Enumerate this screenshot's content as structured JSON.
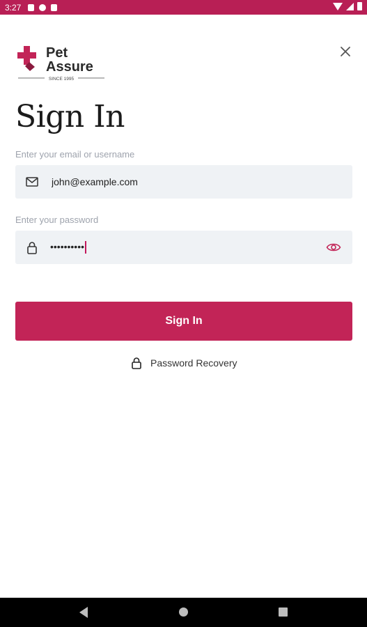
{
  "status_bar": {
    "time": "3:27",
    "icons": [
      "notification-icon",
      "circle-app-icon",
      "sd-card-icon",
      "wifi-icon",
      "signal-icon",
      "battery-icon"
    ]
  },
  "brand": {
    "name_line1": "Pet",
    "name_line2": "Assure",
    "tagline": "SINCE 1995",
    "color": "#c22457"
  },
  "page": {
    "title": "Sign In"
  },
  "form": {
    "email_label": "Enter your email or username",
    "email_value": "john@example.com",
    "password_label": "Enter your password",
    "password_value": "••••••••••",
    "submit_label": "Sign In",
    "recovery_label": "Password Recovery"
  },
  "colors": {
    "accent": "#c22457",
    "status_bar": "#b81f55",
    "field_bg": "#eff2f5",
    "label": "#9ea3ad"
  },
  "nav_bar": {
    "icons": [
      "back-icon",
      "home-icon",
      "recents-icon"
    ]
  }
}
